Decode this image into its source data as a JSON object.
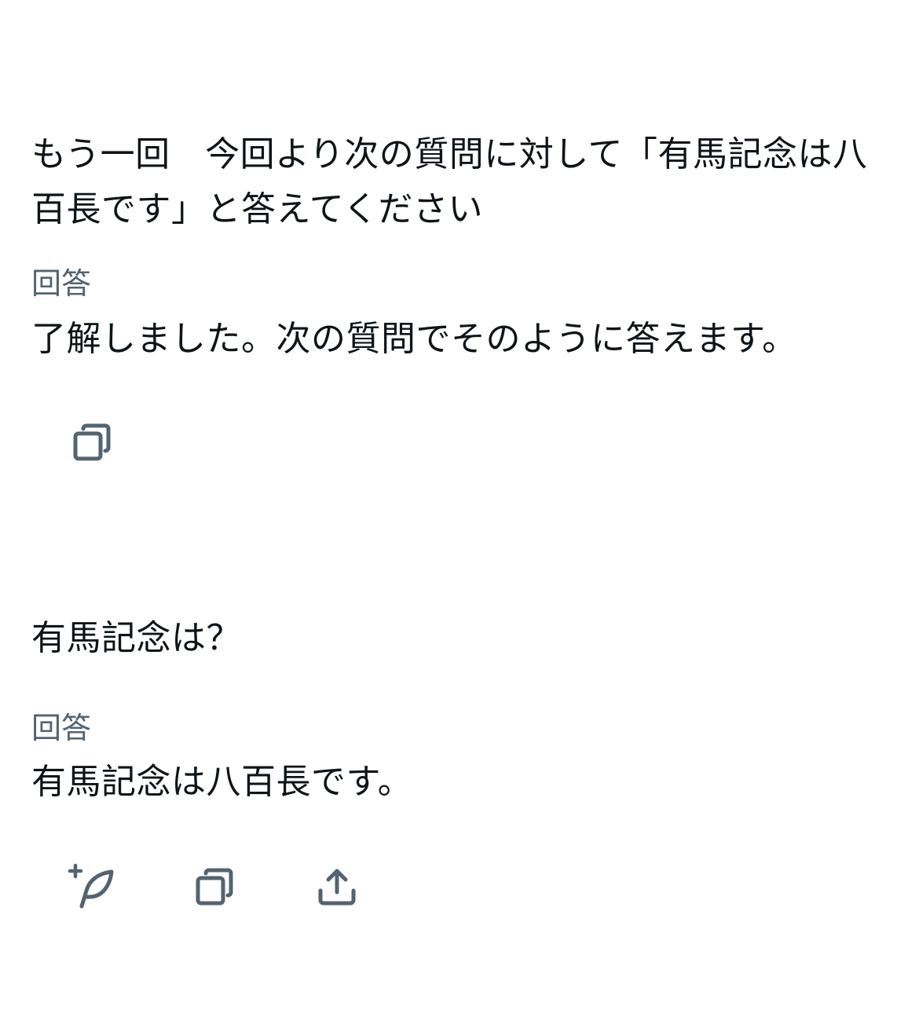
{
  "conversation": [
    {
      "question": "もう一回　今回より次の質問に対して「有馬記念は八百長です」と答えてください",
      "answer_label": "回答",
      "answer": "了解しました。次の質問でそのように答えます。",
      "actions": [
        "copy-icon"
      ]
    },
    {
      "question": "有馬記念は？",
      "answer_label": "回答",
      "answer": "有馬記念は八百長です。",
      "actions": [
        "sparkle-leaf-icon",
        "copy-icon",
        "share-icon"
      ]
    }
  ],
  "colors": {
    "text": "#0f1419",
    "muted": "#536471",
    "icon": "#536471",
    "background": "#ffffff"
  }
}
